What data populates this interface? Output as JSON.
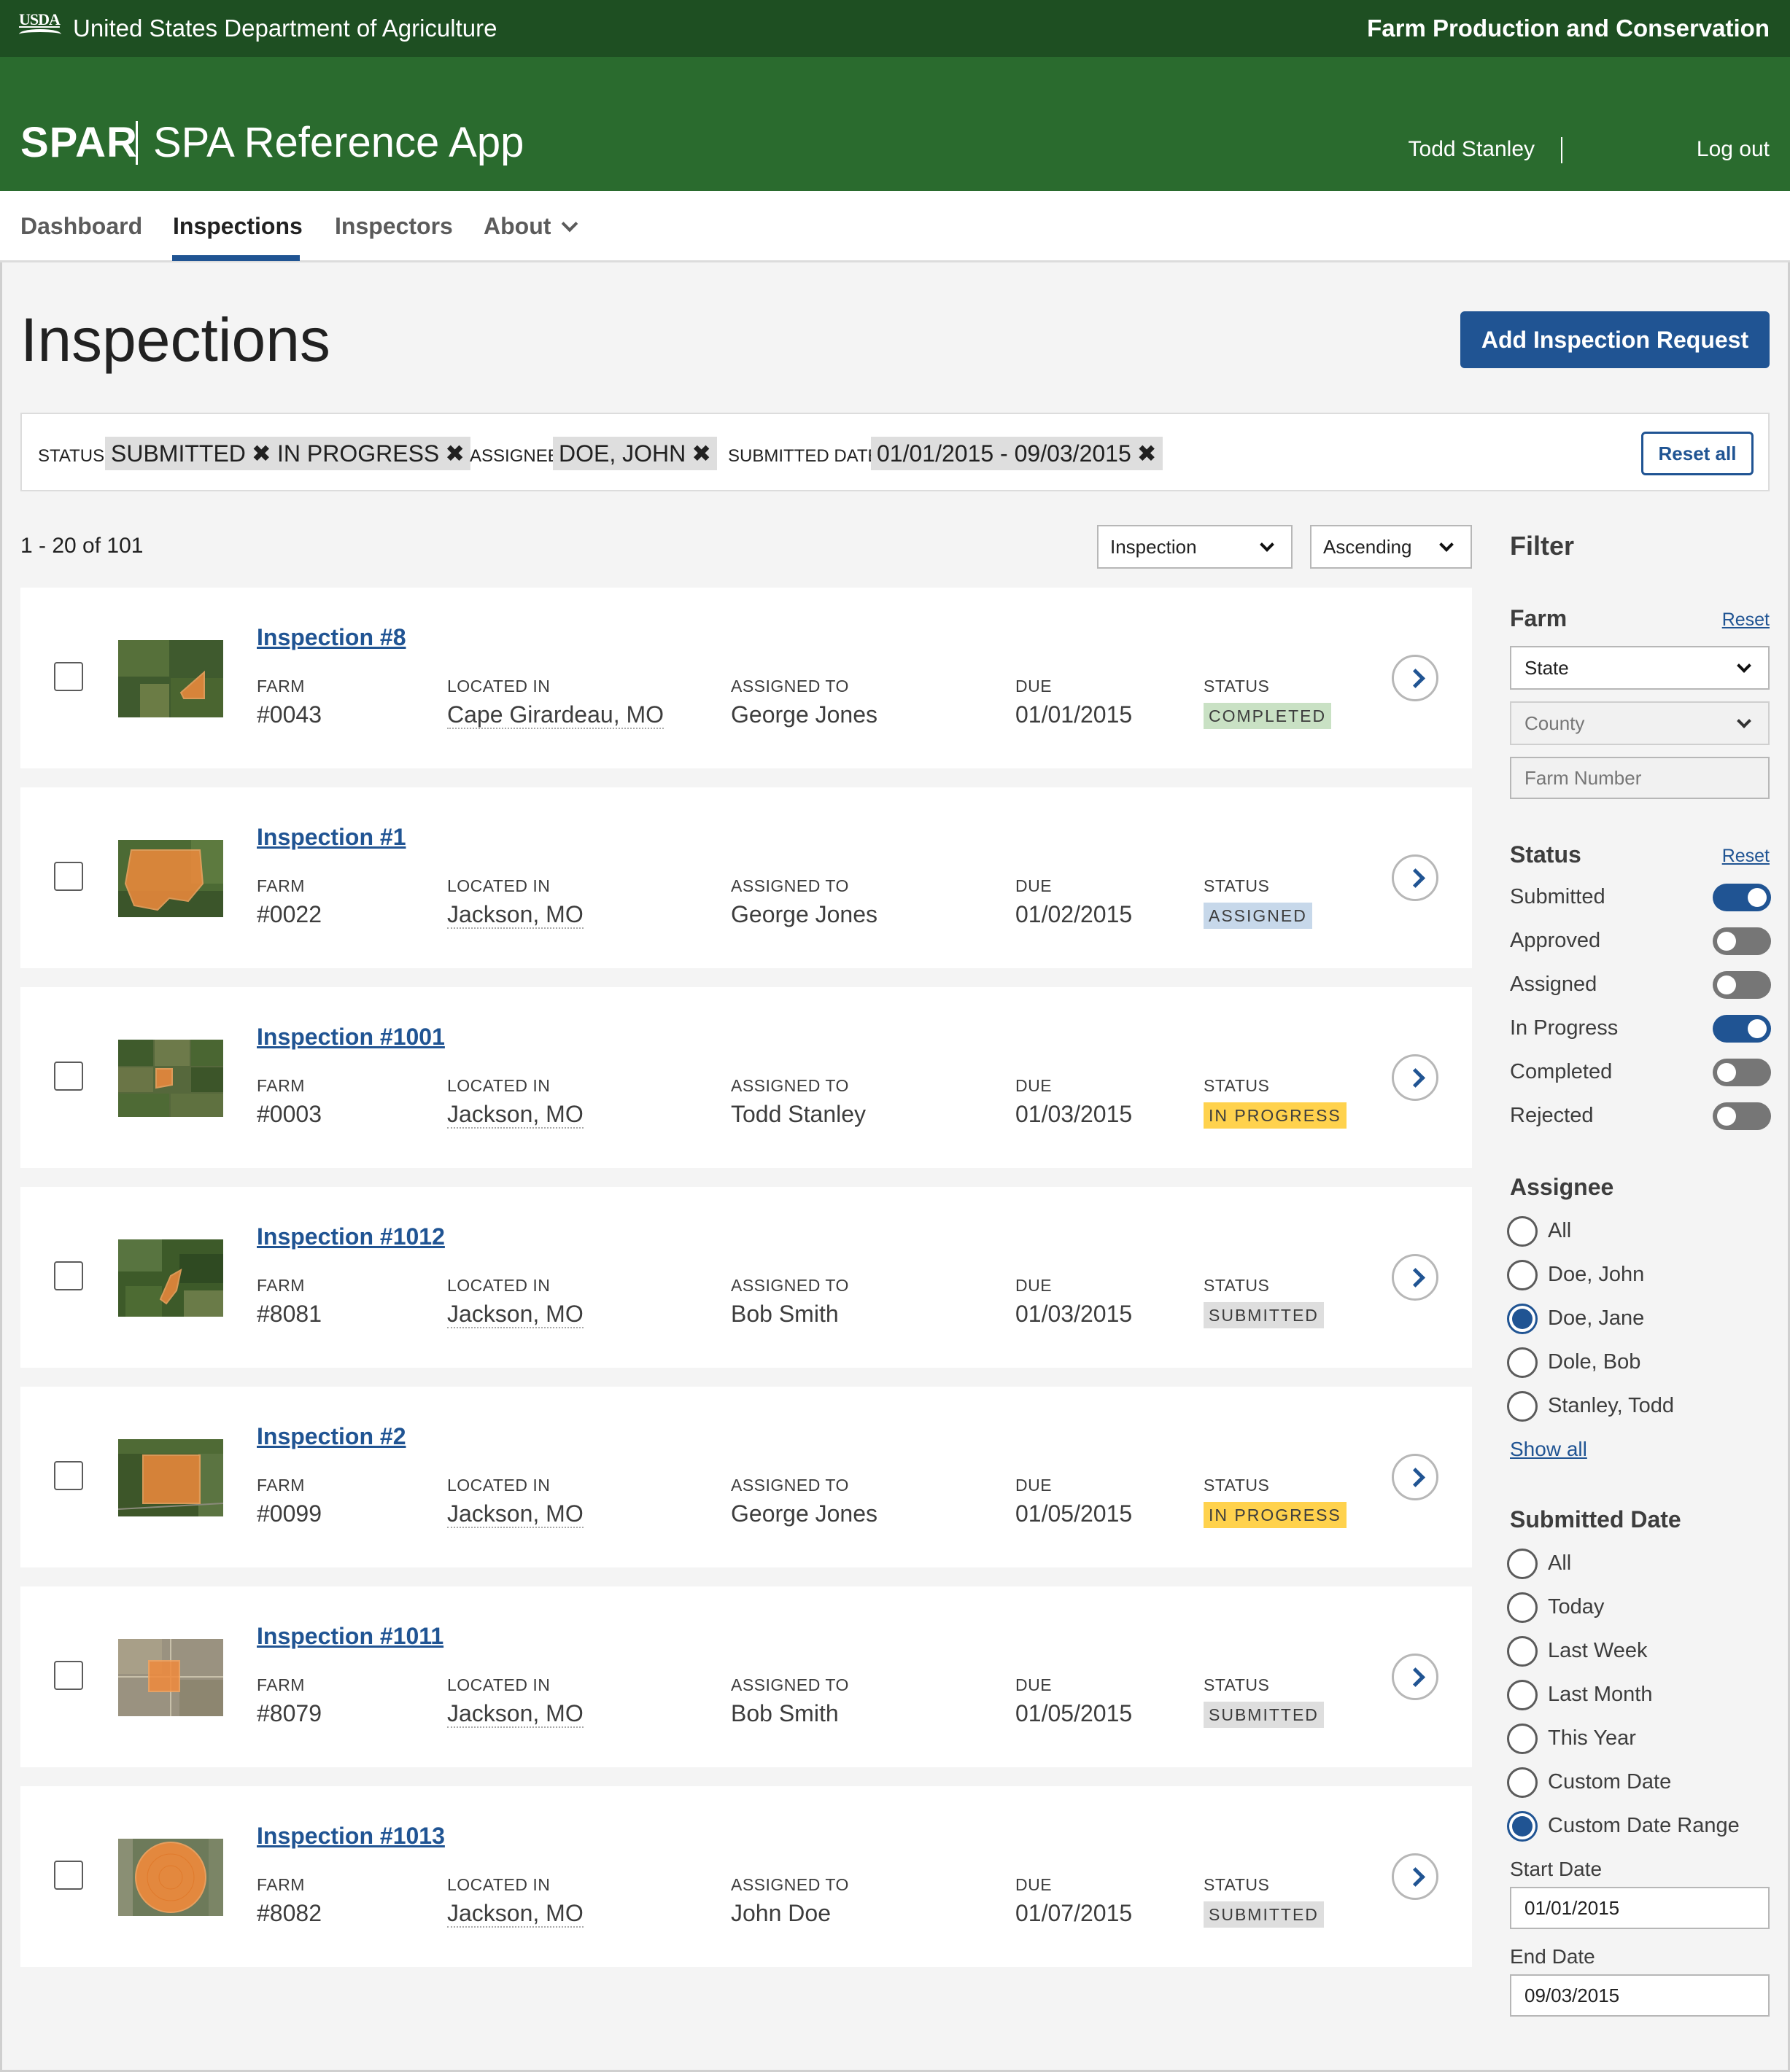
{
  "top_bar": {
    "logo_text": "USDA",
    "agency": "United States Department of Agriculture",
    "mission_area": "Farm Production and Conservation"
  },
  "header": {
    "app_short": "SPAR",
    "app_name": "SPA Reference App",
    "user": "Todd Stanley",
    "logout": "Log out"
  },
  "nav": {
    "dashboard": "Dashboard",
    "inspections": "Inspections",
    "inspectors": "Inspectors",
    "about": "About"
  },
  "page": {
    "title": "Inspections",
    "add_button": "Add Inspection Request"
  },
  "applied_filters": {
    "status_label": "STATUS",
    "status_chips": [
      "SUBMITTED",
      "IN PROGRESS"
    ],
    "assignee_label": "ASSIGNEE",
    "assignee_chip": "DOE, JOHN",
    "date_label": "SUBMITTED DATE",
    "date_chip": "01/01/2015 - 09/03/2015",
    "remove_glyph": "✖",
    "reset_all": "Reset all"
  },
  "results": {
    "count": "1 - 20 of 101",
    "sort_field": "Inspection",
    "sort_order": "Ascending"
  },
  "columns": {
    "farm": "FARM",
    "location": "LOCATED IN",
    "assigned": "ASSIGNED TO",
    "due": "DUE",
    "status": "STATUS"
  },
  "inspections": [
    {
      "title": "Inspection #8",
      "farm": "#0043",
      "location": "Cape Girardeau, MO",
      "assignee": "George Jones",
      "due": "01/01/2015",
      "status": "COMPLETED",
      "status_color": "#c9e1c4"
    },
    {
      "title": "Inspection #1",
      "farm": "#0022",
      "location": "Jackson, MO",
      "assignee": "George Jones",
      "due": "01/02/2015",
      "status": "ASSIGNED",
      "status_color": "#c7d8ea"
    },
    {
      "title": "Inspection #1001",
      "farm": "#0003",
      "location": "Jackson, MO",
      "assignee": "Todd Stanley",
      "due": "01/03/2015",
      "status": "IN PROGRESS",
      "status_color": "#ffd24d"
    },
    {
      "title": "Inspection #1012",
      "farm": "#8081",
      "location": "Jackson, MO",
      "assignee": "Bob Smith",
      "due": "01/03/2015",
      "status": "SUBMITTED",
      "status_color": "#dedede"
    },
    {
      "title": "Inspection #2",
      "farm": "#0099",
      "location": "Jackson, MO",
      "assignee": "George Jones",
      "due": "01/05/2015",
      "status": "IN PROGRESS",
      "status_color": "#ffd24d"
    },
    {
      "title": "Inspection #1011",
      "farm": "#8079",
      "location": "Jackson, MO",
      "assignee": "Bob Smith",
      "due": "01/05/2015",
      "status": "SUBMITTED",
      "status_color": "#dedede"
    },
    {
      "title": "Inspection #1013",
      "farm": "#8082",
      "location": "Jackson, MO",
      "assignee": "John Doe",
      "due": "01/07/2015",
      "status": "SUBMITTED",
      "status_color": "#dedede"
    }
  ],
  "sidebar": {
    "title": "Filter",
    "farm": {
      "heading": "Farm",
      "reset": "Reset",
      "state": "State",
      "county": "County",
      "farm_number_placeholder": "Farm Number"
    },
    "status": {
      "heading": "Status",
      "reset": "Reset",
      "options": [
        {
          "label": "Submitted",
          "on": true
        },
        {
          "label": "Approved",
          "on": false
        },
        {
          "label": "Assigned",
          "on": false
        },
        {
          "label": "In Progress",
          "on": true
        },
        {
          "label": "Completed",
          "on": false
        },
        {
          "label": "Rejected",
          "on": false
        }
      ]
    },
    "assignee": {
      "heading": "Assignee",
      "options": [
        {
          "label": "All",
          "selected": false
        },
        {
          "label": "Doe, John",
          "selected": false
        },
        {
          "label": "Doe, Jane",
          "selected": true
        },
        {
          "label": "Dole, Bob",
          "selected": false
        },
        {
          "label": "Stanley, Todd",
          "selected": false
        }
      ],
      "show_all": "Show all"
    },
    "submitted_date": {
      "heading": "Submitted Date",
      "options": [
        {
          "label": "All",
          "selected": false
        },
        {
          "label": "Today",
          "selected": false
        },
        {
          "label": "Last Week",
          "selected": false
        },
        {
          "label": "Last Month",
          "selected": false
        },
        {
          "label": "This Year",
          "selected": false
        },
        {
          "label": "Custom Date",
          "selected": false
        },
        {
          "label": "Custom Date Range",
          "selected": true
        }
      ],
      "start_label": "Start Date",
      "start_value": "01/01/2015",
      "end_label": "End Date",
      "end_value": "09/03/2015"
    }
  },
  "colors": {
    "top_bar": "#1e4f22",
    "header": "#2a6b2e",
    "primary": "#205493",
    "field_highlight": "#f08a3c"
  }
}
